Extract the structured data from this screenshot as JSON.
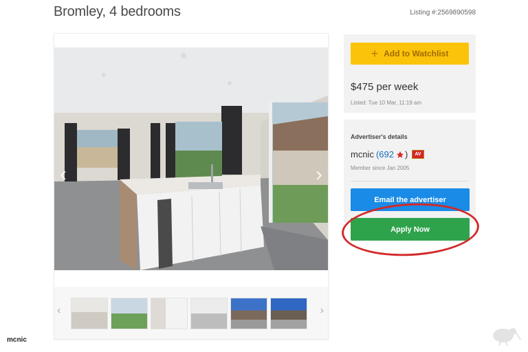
{
  "header": {
    "title": "Bromley, 4 bedrooms",
    "listing_number": "Listing #:2569890598"
  },
  "gallery": {
    "prev_arrow": "‹",
    "next_arrow": "›",
    "thumb_prev": "‹",
    "thumb_next": "›",
    "thumbnail_count": 6
  },
  "sidebar": {
    "watchlist_plus": "+",
    "watchlist_label": "Add to Watchlist",
    "price": "$475 per week",
    "listed": "Listed: Tue 10 Mar, 11:19 am",
    "advertiser_heading": "Advertiser's details",
    "username": "mcnic",
    "rating_open": "(",
    "rating": "692",
    "rating_close": ")",
    "badge": "AV",
    "member_since": "Member since Jan 2005",
    "email_label": "Email the advertiser",
    "apply_label": "Apply Now"
  },
  "footer": {
    "username": "mcnic"
  },
  "colors": {
    "watchlist": "#fbc40b",
    "email": "#1a8be6",
    "apply": "#2fa24c",
    "highlight": "#d22a2a"
  }
}
